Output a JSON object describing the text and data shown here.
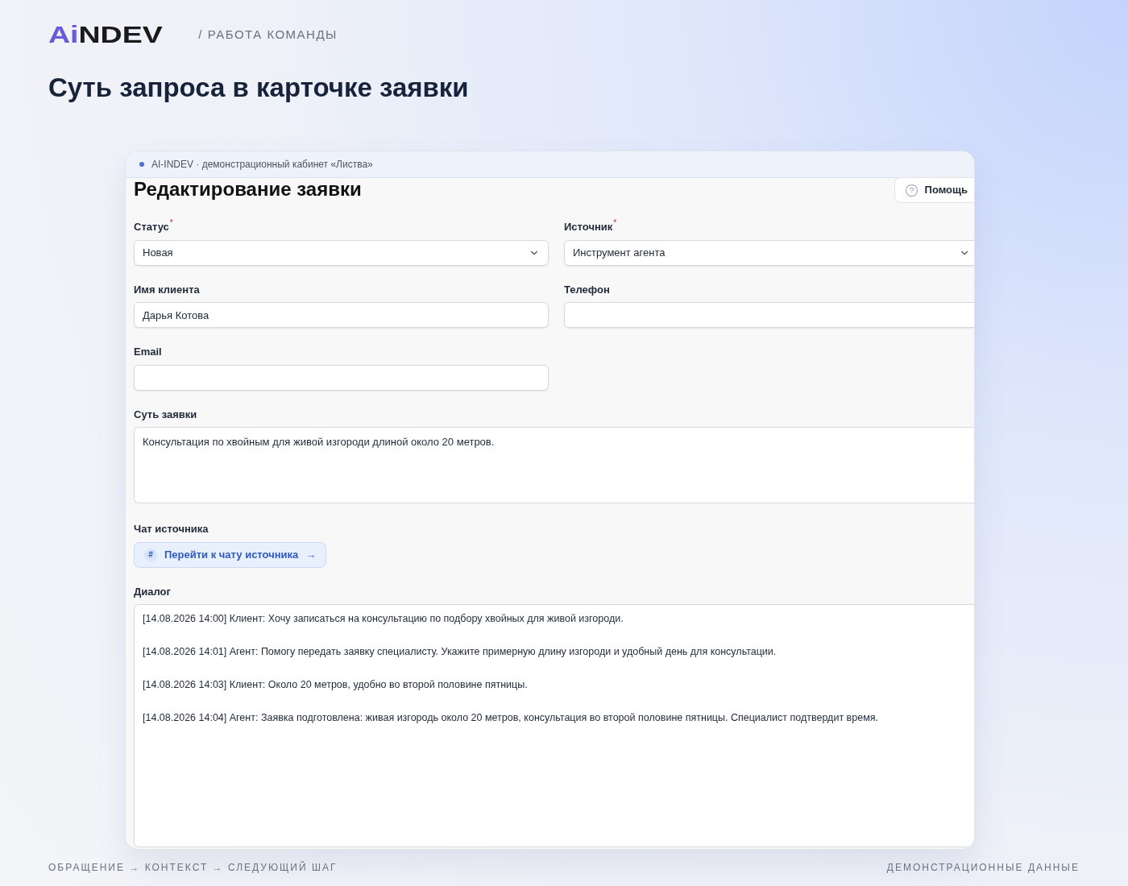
{
  "header": {
    "logo": {
      "accent": "Ai",
      "rest": "NDEV"
    },
    "section": "/ РАБОТА КОМАНДЫ",
    "title": "Суть запроса в карточке заявки"
  },
  "card": {
    "topbar": {
      "text": "AI-INDEV · демонстрационный кабинет «Листва»"
    },
    "heading": "Редактирование заявки",
    "help_button": "Помощь",
    "fields": [
      {
        "kind": "select",
        "label": "Статус",
        "required_mark": "*",
        "value": "Новая"
      },
      {
        "kind": "select",
        "label": "Источник",
        "required_mark": "*",
        "value": "Инструмент агента"
      },
      {
        "kind": "input",
        "label": "Имя клиента",
        "value": "Дарья Котова"
      },
      {
        "kind": "input",
        "label": "Телефон"
      },
      {
        "kind": "input",
        "label": "Email"
      }
    ],
    "summary": {
      "label": "Суть заявки",
      "value": "Консультация по хвойным для живой изгороди длиной около 20 метров."
    },
    "chat": {
      "label": "Чат источника",
      "icon_char": "#",
      "link": "Перейти к чату источника",
      "arrow": "→"
    },
    "dialog": {
      "label": "Диалог",
      "messages": [
        "[14.08.2026 14:00] Клиент: Хочу записаться на консультацию по подбору хвойных для живой изгороди.",
        "[14.08.2026 14:01] Агент: Помогу передать заявку специалисту. Укажите примерную длину изгороди и удобный день для консультации.",
        "[14.08.2026 14:03] Клиент: Около 20 метров, удобно во второй половине пятницы.",
        "[14.08.2026 14:04] Агент: Заявка подготовлена: живая изгородь около 20 метров, консультация во второй половине пятницы. Специалист подтвердит время."
      ]
    }
  },
  "footer": {
    "left": "ОБРАЩЕНИЕ → КОНТЕКСТ → СЛЕДУЮЩИЙ ШАГ",
    "right": "ДЕМОНСТРАЦИОННЫЕ ДАННЫЕ"
  }
}
